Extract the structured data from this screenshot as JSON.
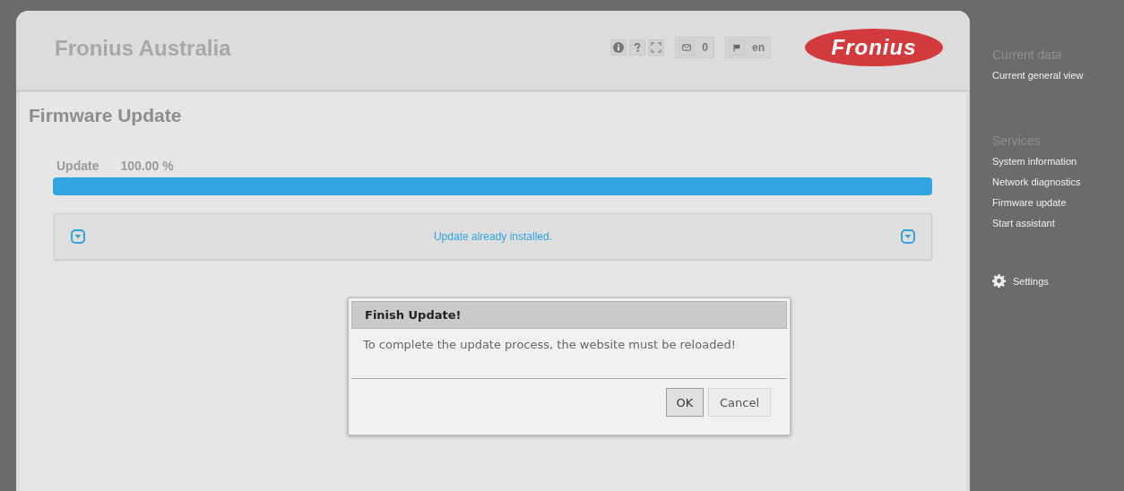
{
  "header": {
    "title": "Fronius Australia",
    "tools": [
      {
        "kind": "info"
      },
      {
        "kind": "help"
      },
      {
        "kind": "fullscreen"
      }
    ],
    "messages": {
      "count": "0"
    },
    "language": {
      "code": "en"
    },
    "logo": "Fronius"
  },
  "page": {
    "title": "Firmware Update",
    "progress": {
      "label": "Update",
      "value": "100.00 %",
      "level": 1
    },
    "status": {
      "message": "Update already installed."
    }
  },
  "sidebar": {
    "sections": [
      {
        "title": "Current data",
        "items": [
          {
            "label": "Current general view"
          }
        ]
      },
      {
        "title": "Services",
        "items": [
          {
            "label": "System information"
          },
          {
            "label": "Network diagnostics"
          },
          {
            "label": "Firmware update"
          },
          {
            "label": "Start assistant"
          }
        ]
      }
    ],
    "settings": {
      "label": "Settings"
    }
  },
  "dialog": {
    "title": "Finish Update!",
    "message": "To complete the update process, the website must be reloaded!",
    "buttons": [
      {
        "label": "OK",
        "kind": "primary"
      },
      {
        "label": "Cancel",
        "kind": "secondary"
      }
    ]
  }
}
